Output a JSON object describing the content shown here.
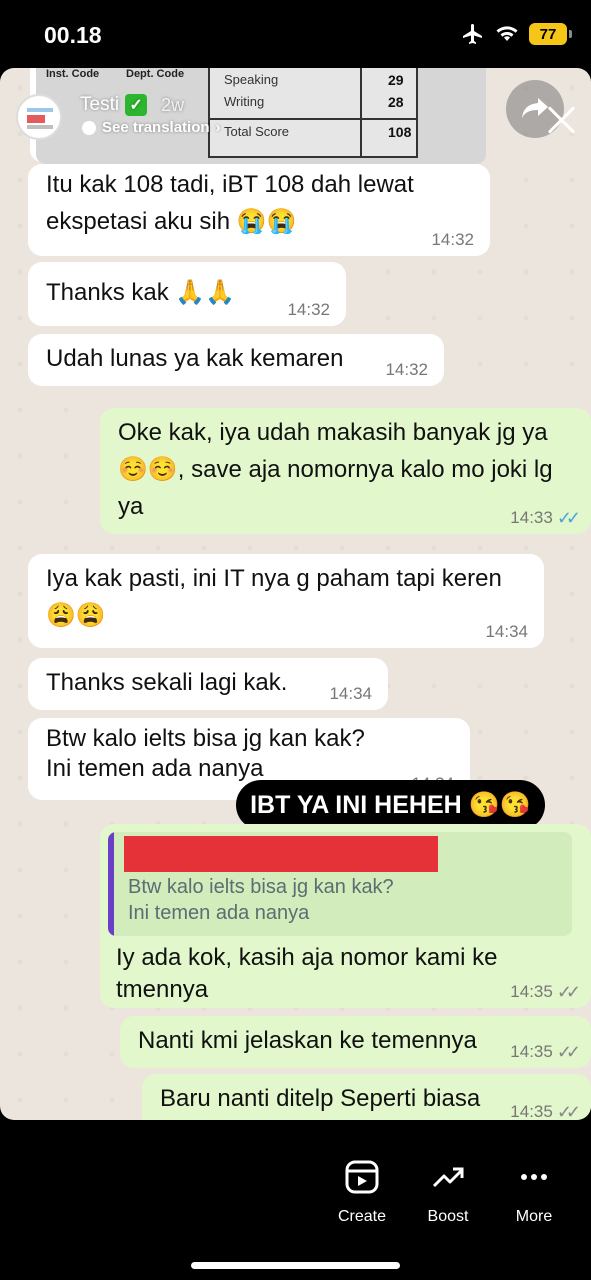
{
  "status": {
    "time": "00.18",
    "battery": "77"
  },
  "story": {
    "user": "Testi",
    "verified_icon": "✅",
    "ago": "2w",
    "see_translation": "See translation"
  },
  "doc": {
    "col1": "Inst. Code",
    "col2": "Dept. Code",
    "rows": [
      {
        "label": "Speaking",
        "value": "29"
      },
      {
        "label": "Writing",
        "value": "28"
      },
      {
        "label": "Total Score",
        "value": "108"
      }
    ]
  },
  "messages": [
    {
      "dir": "in",
      "line1": "Itu kak 108 tadi, iBT 108 dah lewat",
      "line2": "ekspetasi aku sih 😭😭",
      "time": "14:32"
    },
    {
      "dir": "in",
      "line1": "Thanks kak 🙏🙏",
      "time": "14:32"
    },
    {
      "dir": "in",
      "line1": "Udah lunas ya kak kemaren",
      "time": "14:32"
    },
    {
      "dir": "out",
      "line1": "Oke kak, iya udah makasih banyak jg ya",
      "line2": "☺️☺️, save aja nomornya kalo mo joki lg",
      "line3": "ya",
      "time": "14:33"
    },
    {
      "dir": "in",
      "line1": "Iya kak pasti, ini IT nya g paham tapi keren",
      "line2": "😩😩",
      "time": "14:34"
    },
    {
      "dir": "in",
      "line1": "Thanks sekali lagi kak.",
      "time": "14:34"
    },
    {
      "dir": "in",
      "line1": "Btw kalo ielts bisa jg kan kak?",
      "line2": "Ini temen ada nanya",
      "time": "14:34"
    },
    {
      "dir": "out",
      "quote1": "Btw kalo ielts bisa jg kan kak?",
      "quote2": "Ini temen ada nanya",
      "line1": "Iy ada kok, kasih aja nomor kami ke",
      "line2": "tmennya",
      "time": "14:35"
    },
    {
      "dir": "out",
      "line1": "Nanti kmi jelaskan ke temennya",
      "time": "14:35"
    },
    {
      "dir": "out",
      "line1": "Baru nanti ditelp Seperti biasa",
      "time": "14:35"
    }
  ],
  "sticker_text": "IBT YA INI HEHEH 😘😘",
  "bottom_actions": [
    {
      "label": "Create",
      "icon": "create-icon"
    },
    {
      "label": "Boost",
      "icon": "boost-icon"
    },
    {
      "label": "More",
      "icon": "more-icon"
    }
  ]
}
